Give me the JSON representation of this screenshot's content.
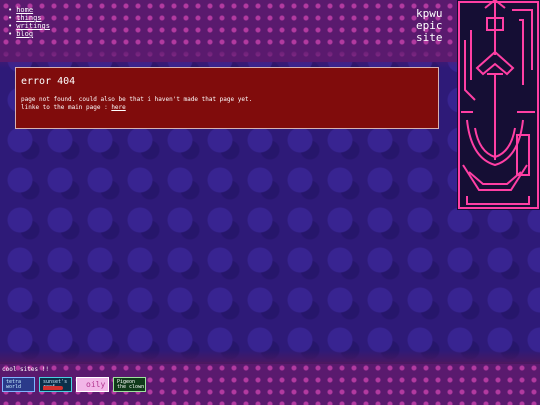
{
  "nav": [
    {
      "label": "home"
    },
    {
      "label": "things"
    },
    {
      "label": "writings"
    },
    {
      "label": "blog"
    }
  ],
  "site": {
    "title_lines": [
      "kpwu",
      "epic",
      "site"
    ]
  },
  "error": {
    "title": "error 404",
    "line1": "page not found. could also be that i haven't made that page yet.",
    "line2_prefix": "linke to the main page : ",
    "line2_link": "here"
  },
  "cool_sites": {
    "label": "cool sites !!",
    "buttons": [
      {
        "name": "button-1",
        "line1": "tetra",
        "line2": "world"
      },
      {
        "name": "button-2",
        "line1": "sunset's",
        "line2": "reef"
      },
      {
        "name": "button-3",
        "line1": "oily"
      },
      {
        "name": "button-4",
        "line1": "Pigeon",
        "line2": "the clown"
      }
    ]
  },
  "colors": {
    "accent": "#ff3fa4",
    "error_bg": "#800c0c",
    "background": "#2e1a78"
  },
  "icons": {
    "side_art": "neon-anchor-icon"
  }
}
